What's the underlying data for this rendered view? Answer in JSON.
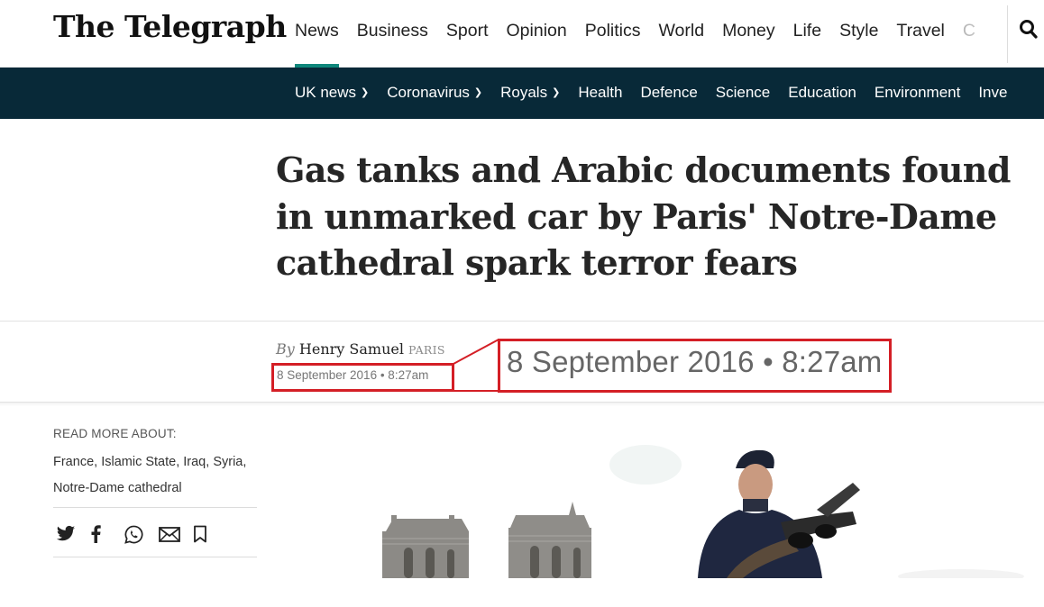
{
  "brand": {
    "logo_text": "The Telegraph"
  },
  "main_nav": {
    "items": [
      {
        "label": "News",
        "active": true
      },
      {
        "label": "Business"
      },
      {
        "label": "Sport"
      },
      {
        "label": "Opinion"
      },
      {
        "label": "Politics"
      },
      {
        "label": "World"
      },
      {
        "label": "Money"
      },
      {
        "label": "Life"
      },
      {
        "label": "Style"
      },
      {
        "label": "Travel"
      },
      {
        "label": "C"
      }
    ],
    "search_icon": "search-icon"
  },
  "sub_nav": {
    "items": [
      {
        "label": "UK news",
        "dropdown": true
      },
      {
        "label": "Coronavirus",
        "dropdown": true
      },
      {
        "label": "Royals",
        "dropdown": true
      },
      {
        "label": "Health"
      },
      {
        "label": "Defence"
      },
      {
        "label": "Science"
      },
      {
        "label": "Education"
      },
      {
        "label": "Environment"
      },
      {
        "label": "Inve"
      }
    ]
  },
  "article": {
    "headline": "Gas tanks and Arabic documents found in unmarked car by Paris' Notre-Dame cathedral spark terror fears",
    "byline_prefix": "By",
    "author": "Henry Samuel",
    "location": "PARIS",
    "date": "8 September 2016 • 8:27am"
  },
  "callout": {
    "date_zoomed": "8 September 2016 • 8:27am"
  },
  "read_more": {
    "label": "READ MORE ABOUT:",
    "tags": [
      "France",
      "Islamic State",
      "Iraq",
      "Syria",
      "Notre-Dame cathedral"
    ]
  },
  "share_icons": [
    "twitter-icon",
    "facebook-icon",
    "whatsapp-icon",
    "email-icon",
    "bookmark-icon"
  ],
  "colors": {
    "accent": "#0f877b",
    "subnav_bg": "#082938",
    "callout_red": "#d41f26"
  }
}
